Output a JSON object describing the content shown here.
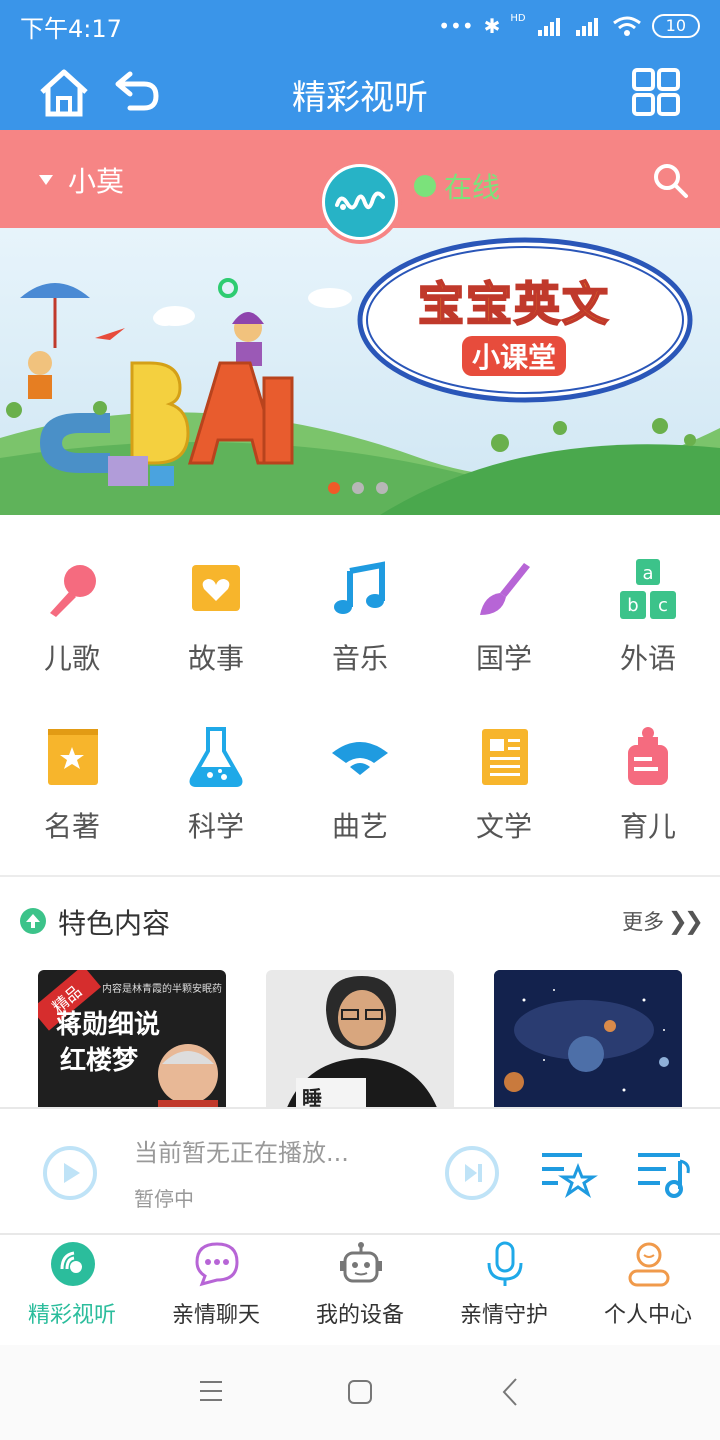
{
  "status_bar": {
    "time": "下午4:17",
    "hd": "HD",
    "battery": "10"
  },
  "header": {
    "title": "精彩视听"
  },
  "user_bar": {
    "name": "小莫",
    "status": "在线"
  },
  "banner": {
    "title": "宝宝英文",
    "subtitle": "小课堂",
    "letters": "CBAI",
    "dots": 3,
    "active_dot": 0
  },
  "categories": [
    {
      "label": "儿歌",
      "icon": "microphone-icon",
      "color": "#f56b7f"
    },
    {
      "label": "故事",
      "icon": "heart-book-icon",
      "color": "#f7b52c"
    },
    {
      "label": "音乐",
      "icon": "music-note-icon",
      "color": "#1f9be0"
    },
    {
      "label": "国学",
      "icon": "brush-icon",
      "color": "#b765d6"
    },
    {
      "label": "外语",
      "icon": "abc-blocks-icon",
      "color": "#3cc38a"
    },
    {
      "label": "名著",
      "icon": "star-book-icon",
      "color": "#f7b52c"
    },
    {
      "label": "科学",
      "icon": "flask-icon",
      "color": "#1fa9e8"
    },
    {
      "label": "曲艺",
      "icon": "fan-icon",
      "color": "#1f9be0"
    },
    {
      "label": "文学",
      "icon": "document-icon",
      "color": "#f7b52c"
    },
    {
      "label": "育儿",
      "icon": "baby-bottle-icon",
      "color": "#f56b7f"
    }
  ],
  "featured": {
    "title": "特色内容",
    "more": "更多",
    "items": [
      {
        "badge": "精品",
        "caption_small": "内容是林青霞的半颗安眠药",
        "caption_big1": "蒋勋细说",
        "caption_big2": "红楼梦"
      },
      {
        "caption": "睡"
      },
      {
        "caption": ""
      }
    ]
  },
  "player": {
    "now_playing": "当前暂无正在播放...",
    "state": "暂停中"
  },
  "tabs": [
    {
      "label": "精彩视听",
      "icon": "audio-disc-icon",
      "active": true
    },
    {
      "label": "亲情聊天",
      "icon": "chat-bubble-icon",
      "active": false
    },
    {
      "label": "我的设备",
      "icon": "robot-icon",
      "active": false
    },
    {
      "label": "亲情守护",
      "icon": "microphone-icon",
      "active": false
    },
    {
      "label": "个人中心",
      "icon": "person-icon",
      "active": false
    }
  ],
  "colors": {
    "primary": "#3a95e9",
    "accent_pink": "#f68585",
    "online": "#7be27b",
    "active_tab": "#2bbd9c"
  }
}
